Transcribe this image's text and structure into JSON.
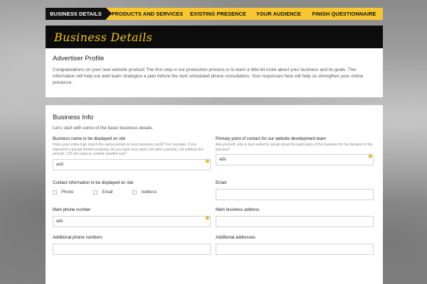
{
  "steps": [
    {
      "label": "BUSINESS DETAILS"
    },
    {
      "label": "PRODUCTS AND SERVICES"
    },
    {
      "label": "EXISTING PRESENCE"
    },
    {
      "label": "YOUR AUDIENCE"
    },
    {
      "label": "FINISH QUESTIONNAIRE"
    }
  ],
  "hero": {
    "title": "Business Details"
  },
  "profile": {
    "title": "Advertiser Profile",
    "text": "Congratulations on your new website product! The first step in our production process is to learn a little bit more about your business and its goals. This information will help our web team strategize a plan before the next scheduled phone consultation. Your responses here will help us strengthen your online presence."
  },
  "info": {
    "title": "Business Info",
    "intro": "Let's start with some of the basic business details.",
    "business_name": {
      "label": "Business name to be displayed on site",
      "hint": "Does your online logo match the name printed on your business cards? For example, if you represent a private limited company, do you spell your name Ltd (with a period), Ltd (without the period), LTD (all caps) or Limited (spelled out)?",
      "value": "asd"
    },
    "primary_contact": {
      "label": "Primary point of contact for our website development team",
      "hint": "Ask yourself, who is best suited to speak about the particulars of the business for the duration of the process?",
      "value": "ads"
    },
    "contact_info": {
      "label": "Contact information to be displayed on site",
      "options": [
        "Phone",
        "Email",
        "Address"
      ]
    },
    "email": {
      "label": "Email",
      "value": ""
    },
    "main_phone": {
      "label": "Main phone number",
      "value": "ads"
    },
    "main_address": {
      "label": "Main business address",
      "value": ""
    },
    "additional_phones": {
      "label": "Additional phone numbers"
    },
    "additional_addresses": {
      "label": "Additional addresses"
    }
  },
  "colors": {
    "accent": "#f7c731",
    "dark": "#0c0c0c"
  },
  "icons": {
    "required": "required-star-icon"
  }
}
